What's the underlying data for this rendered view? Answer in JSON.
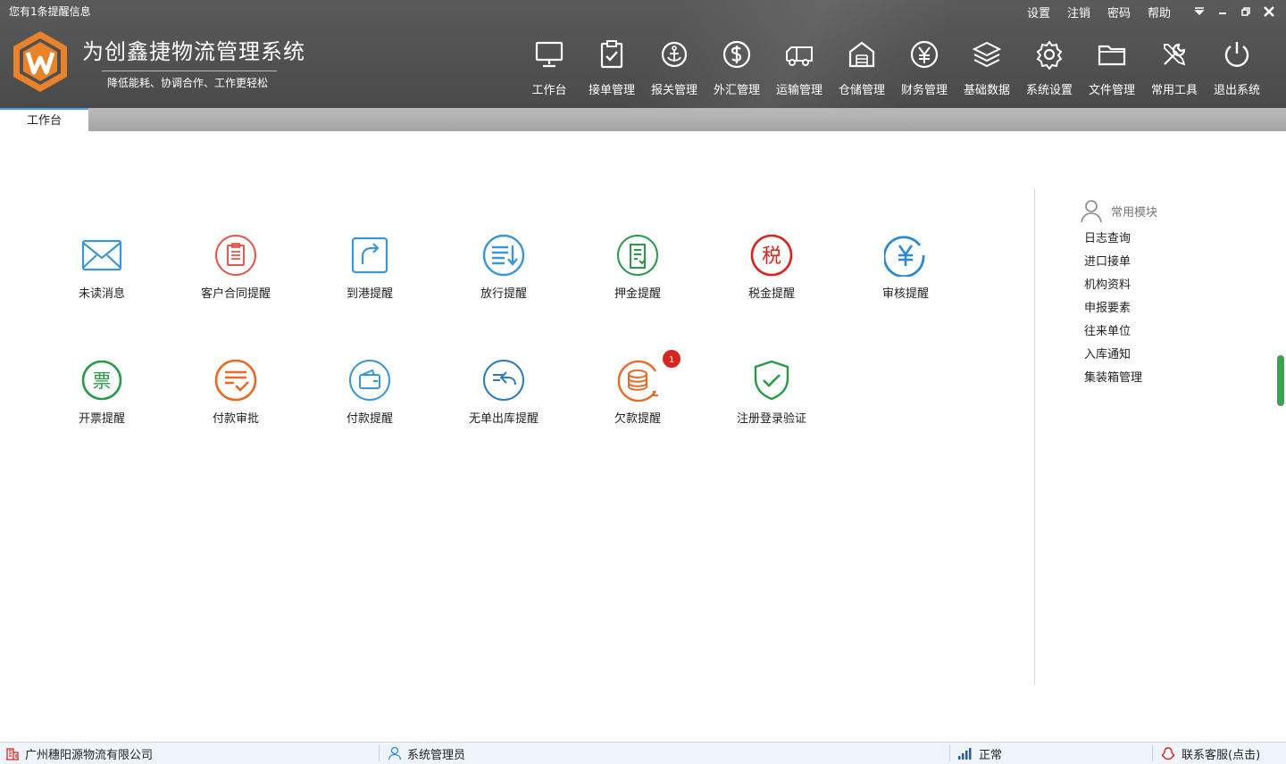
{
  "header": {
    "notice": "您有1条提醒信息",
    "links": [
      "设置",
      "注销",
      "密码",
      "帮助"
    ],
    "app_title": "为创鑫捷物流管理系统",
    "app_subtitle": "降低能耗、协调合作、工作更轻松"
  },
  "modules": [
    "工作台",
    "接单管理",
    "报关管理",
    "外汇管理",
    "运输管理",
    "仓储管理",
    "财务管理",
    "基础数据",
    "系统设置",
    "文件管理",
    "常用工具",
    "退出系统"
  ],
  "tabs": [
    "工作台"
  ],
  "reminders": [
    {
      "label": "未读消息",
      "icon": "mail-icon",
      "color": "#3a97d4"
    },
    {
      "label": "客户合同提醒",
      "icon": "clipboard-icon",
      "color": "#e2574c"
    },
    {
      "label": "到港提醒",
      "icon": "arrival-icon",
      "color": "#3a97d4"
    },
    {
      "label": "放行提醒",
      "icon": "release-icon",
      "color": "#3a97d4"
    },
    {
      "label": "押金提醒",
      "icon": "deposit-icon",
      "color": "#2a9a4a"
    },
    {
      "label": "税金提醒",
      "icon": "tax-icon",
      "color": "#d9261c"
    },
    {
      "label": "审核提醒",
      "icon": "yen-icon",
      "color": "#2a8ad4"
    },
    {
      "label": "开票提醒",
      "icon": "invoice-icon",
      "color": "#2a9a4a"
    },
    {
      "label": "付款审批",
      "icon": "payment-approval-icon",
      "color": "#e86a26"
    },
    {
      "label": "付款提醒",
      "icon": "wallet-icon",
      "color": "#3a97d4"
    },
    {
      "label": "无单出库提醒",
      "icon": "outbound-icon",
      "color": "#2a7ac4"
    },
    {
      "label": "欠款提醒",
      "icon": "coins-icon",
      "color": "#e86a26",
      "badge": "1"
    },
    {
      "label": "注册登录验证",
      "icon": "shield-check-icon",
      "color": "#2a9a4a"
    }
  ],
  "sidebar": {
    "title": "常用模块",
    "items": [
      "日志查询",
      "进口接单",
      "机构资料",
      "申报要素",
      "往来单位",
      "入库通知",
      "集装箱管理"
    ]
  },
  "status": {
    "company": "广州穗阳源物流有限公司",
    "user": "系统管理员",
    "network": "正常",
    "support": "联系客服(点击)"
  }
}
